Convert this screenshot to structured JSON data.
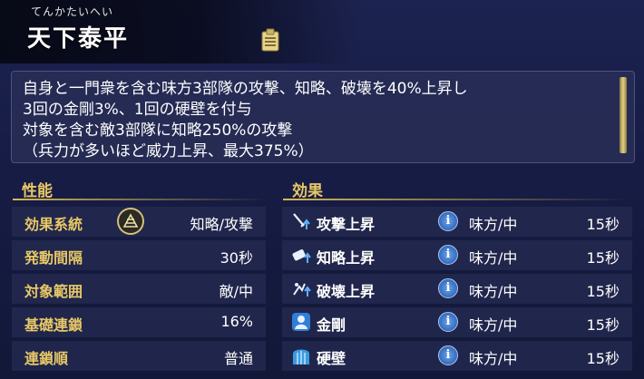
{
  "header": {
    "ruby": "てんかたいへい",
    "title": "天下泰平",
    "memo_icon": "memo-icon"
  },
  "description": {
    "lines": [
      "自身と一門衆を含む味方3部隊の攻撃、知略、破壊を40%上昇し",
      "3回の金剛3%、1回の硬壁を付与",
      "対象を含む敵3部隊に知略250%の攻撃",
      "（兵力が多いほど威力上昇、最大375%）"
    ]
  },
  "performance": {
    "title": "性能",
    "rows": [
      {
        "label": "効果系統",
        "value": "知略/攻撃",
        "icon": "strategy-type-icon"
      },
      {
        "label": "発動間隔",
        "value": "30秒"
      },
      {
        "label": "対象範囲",
        "value": "敵/中"
      },
      {
        "label": "基礎連鎖",
        "value": "16%"
      },
      {
        "label": "連鎖順",
        "value": "普通"
      }
    ]
  },
  "effects": {
    "title": "効果",
    "rows": [
      {
        "name": "攻撃上昇",
        "icon": "attack-up-icon",
        "target": "味方/中",
        "duration": "15秒"
      },
      {
        "name": "知略上昇",
        "icon": "strategy-up-icon",
        "target": "味方/中",
        "duration": "15秒"
      },
      {
        "name": "破壊上昇",
        "icon": "destruction-up-icon",
        "target": "味方/中",
        "duration": "15秒"
      },
      {
        "name": "金剛",
        "icon": "diamond-guard-icon",
        "target": "味方/中",
        "duration": "15秒"
      },
      {
        "name": "硬壁",
        "icon": "hard-wall-icon",
        "target": "味方/中",
        "duration": "15秒"
      }
    ],
    "info_glyph": "i"
  },
  "colors": {
    "accent_gold": "#e8c867",
    "background": "#161c44",
    "panel": "#222850"
  }
}
